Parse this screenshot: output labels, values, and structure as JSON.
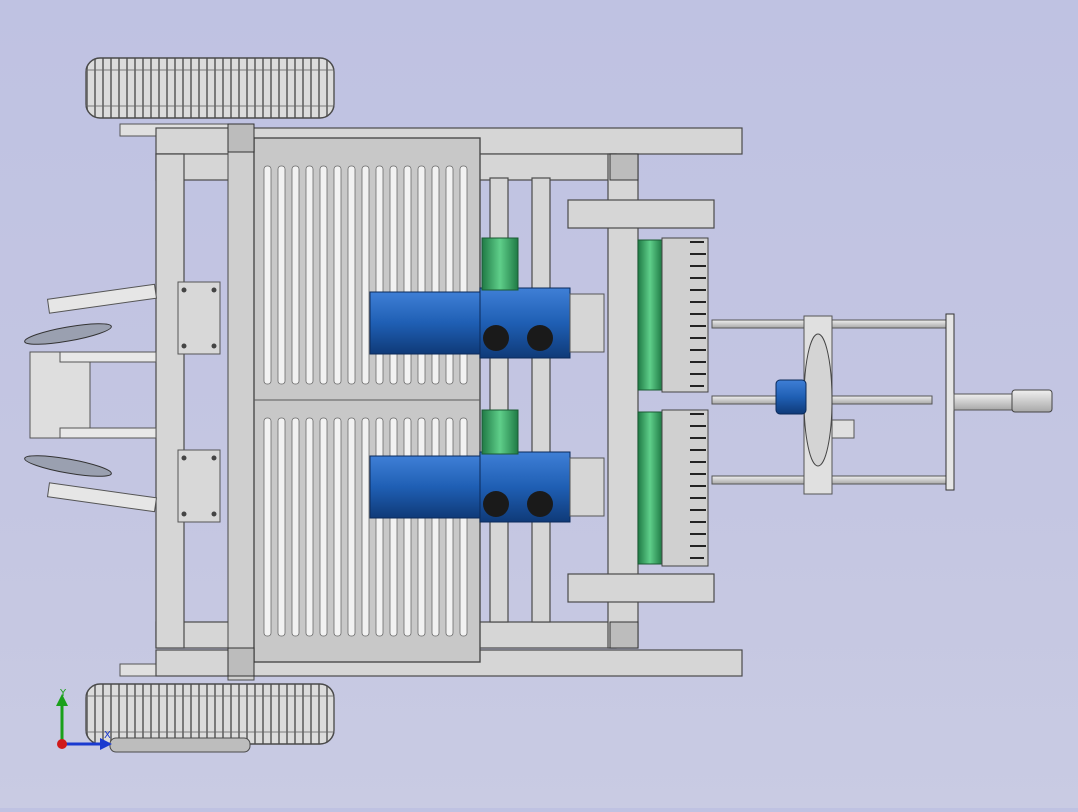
{
  "viewport": {
    "background_top": "#bfc2e2",
    "background_bottom": "#c9cbe3"
  },
  "model": {
    "frame_color": "#d3d3d3",
    "frame_edge": "#4a4a4a",
    "motor_color": "#1f5fb4",
    "motor_dark": "#0f3a78",
    "gear_green": "#2e9a5a",
    "wheel_color": "#cfcfcf"
  },
  "triad": {
    "y_label": "Y",
    "x_label": "X",
    "y_color": "#1aa01a",
    "x_color": "#1a3ad0",
    "z_color": "#d01a1a"
  }
}
